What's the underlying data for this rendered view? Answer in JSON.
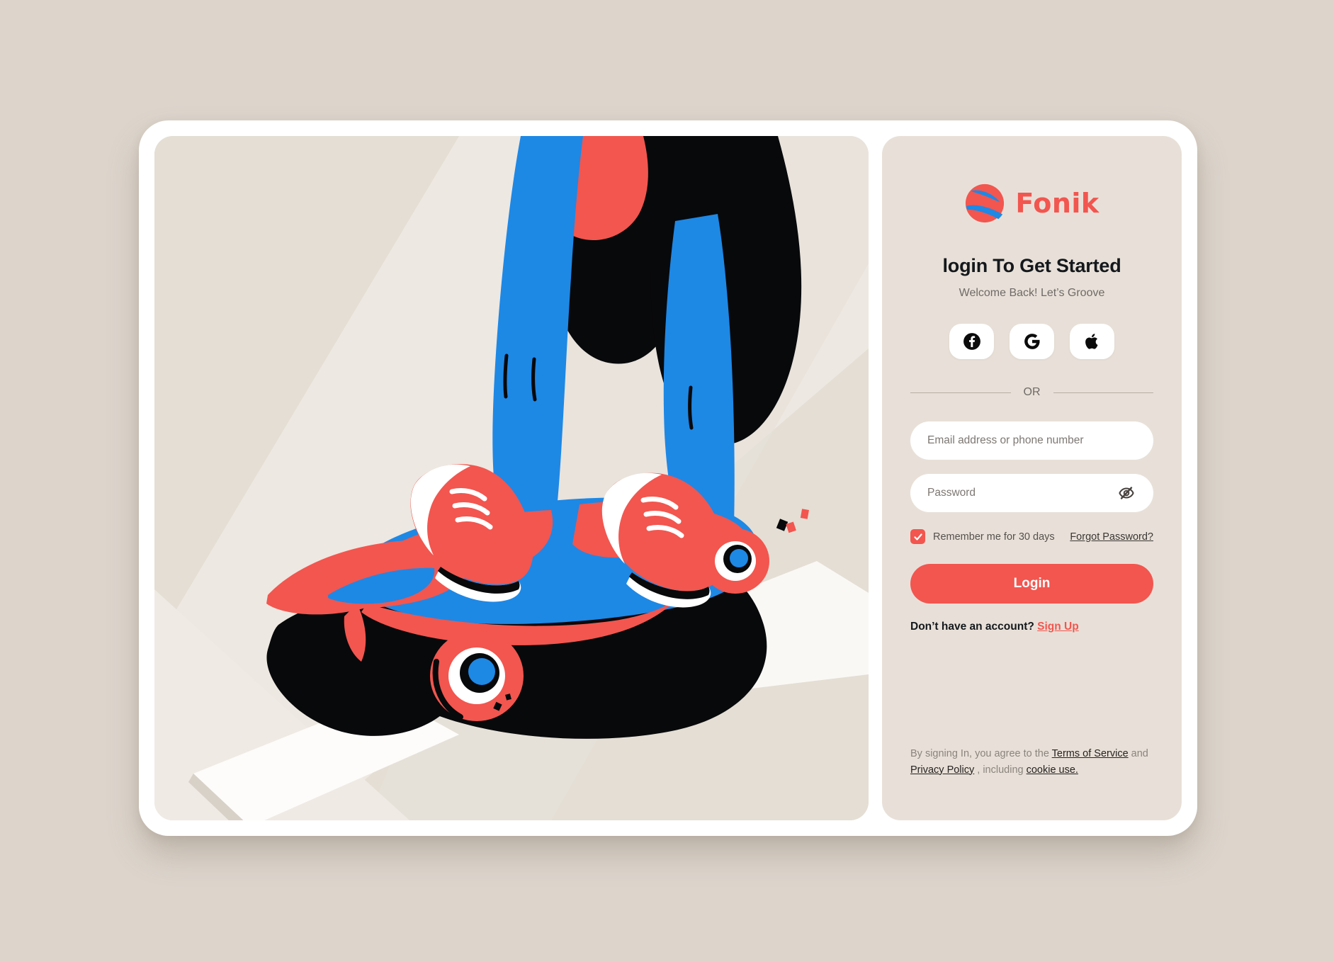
{
  "brand": {
    "name": "Fonik",
    "logo_icon": "fonik-ball-logo-icon",
    "accent_color": "#F2564F",
    "secondary_color": "#1E88E5"
  },
  "form": {
    "heading": "login To Get Started",
    "subheading": "Welcome Back! Let’s Groove",
    "social_buttons": [
      {
        "name": "facebook",
        "icon": "facebook-icon",
        "label": "Facebook"
      },
      {
        "name": "google",
        "icon": "google-icon",
        "label": "Google"
      },
      {
        "name": "apple",
        "icon": "apple-icon",
        "label": "Apple"
      }
    ],
    "divider_label": "OR",
    "email": {
      "placeholder": "Email address or phone number",
      "value": ""
    },
    "password": {
      "placeholder": "Password",
      "value": "",
      "toggle_icon": "eye-slash-icon"
    },
    "remember": {
      "label": "Remember me for 30 days",
      "checked": true
    },
    "forgot_label": "Forgot Password?",
    "submit_label": "Login",
    "signup_prompt": "Don’t have an account?",
    "signup_label": "Sign Up"
  },
  "legal": {
    "lead": "By signing In, you agree to the ",
    "terms": "Terms of Service",
    "and": " and ",
    "privacy": "Privacy Policy",
    "middle": " , including ",
    "cookies": "cookie use."
  },
  "illustration": {
    "name": "skateboarder-legs-illustration",
    "description": "Legs in blue pants with coral sneakers on a coral and blue skateboard",
    "background": "#E4DED4",
    "colors": {
      "coral": "#F2564F",
      "blue": "#1E88E5",
      "black": "#08090B",
      "white": "#FFFFFF",
      "floor": "#E4DED4",
      "floor_light": "#EFEAE3",
      "tile": "#FDFCFA"
    }
  }
}
